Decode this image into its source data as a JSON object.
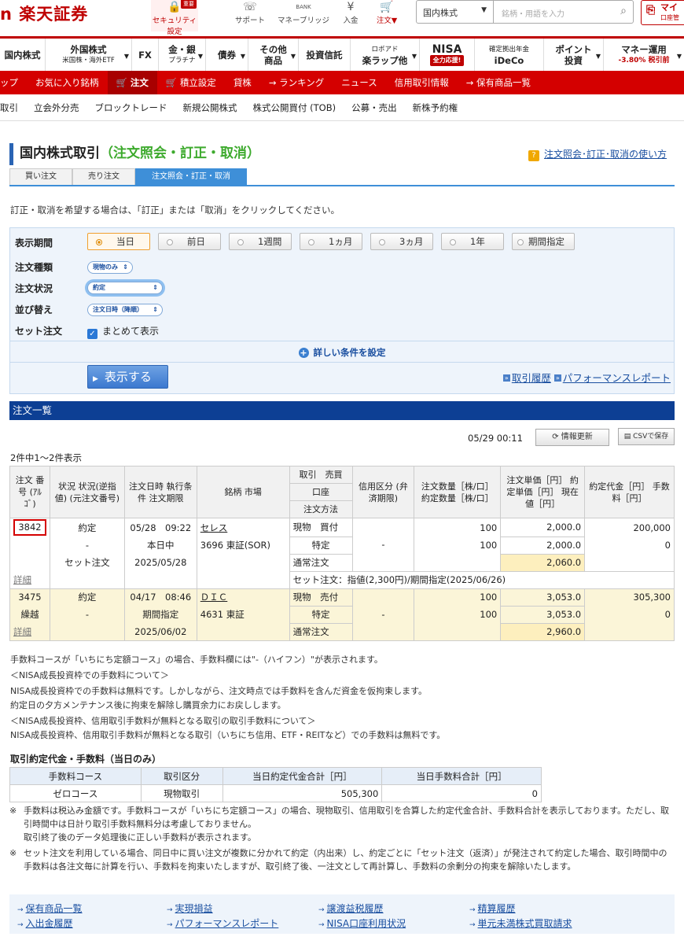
{
  "header": {
    "logo": "n 楽天証券",
    "icons": [
      {
        "label": "セキュリティ設定",
        "icon": "lock-icon",
        "badge": "重要"
      },
      {
        "label": "サポート",
        "icon": "support-icon"
      },
      {
        "label": "マネーブリッジ",
        "icon": "bank-icon",
        "small": "BANK"
      },
      {
        "label": "入金",
        "icon": "deposit-icon"
      },
      {
        "label": "注文▼",
        "icon": "cart-icon"
      }
    ],
    "market_select": "国内株式",
    "search_placeholder": "銘柄・用語を入力",
    "my": "マイ",
    "my_sub": "口座管"
  },
  "category_nav": [
    {
      "label": "国内株式"
    },
    {
      "label": "外国株式",
      "sub": "米国株・海外ETF",
      "dd": true
    },
    {
      "label": "FX"
    },
    {
      "label": "金・銀",
      "sub": "プラチナ",
      "dd": true
    },
    {
      "label": "債券",
      "dd": true
    },
    {
      "label": "その他",
      "sub": "商品",
      "dd": true
    },
    {
      "label": "投資信託"
    },
    {
      "label": "ロボアド",
      "sub": "楽ラップ他",
      "dd": true
    },
    {
      "label": "NISA",
      "sub": "全力応援!"
    },
    {
      "label": "確定拠出年金",
      "sub": "iDeCo"
    },
    {
      "label": "ポイント",
      "sub": "投資",
      "dd": true
    },
    {
      "label": "マネー運用",
      "sub": "-3.80% 税引前",
      "dd": true
    }
  ],
  "red_nav": [
    "ップ",
    "お気に入り銘柄",
    "注文",
    "積立設定",
    "貸株",
    "→ ランキング",
    "ニュース",
    "信用取引情報",
    "→ 保有商品一覧"
  ],
  "sub_nav": [
    "取引",
    "立会外分売",
    "ブロックトレード",
    "新規公開株式",
    "株式公開買付 (TOB)",
    "公募・売出",
    "新株予約権"
  ],
  "title": {
    "main": "国内株式取引",
    "sub": "（注文照会・訂正・取消）",
    "help": "注文照会･訂正･取消の使い方"
  },
  "tabs": [
    "買い注文",
    "売り注文",
    "注文照会・訂正・取消"
  ],
  "instruction": "訂正・取消を希望する場合は、「訂正」または「取消」をクリックしてください。",
  "filter": {
    "period_label": "表示期間",
    "periods": [
      "当日",
      "前日",
      "1週間",
      "1ヵ月",
      "3ヵ月",
      "1年",
      "期間指定"
    ],
    "type_label": "注文種類",
    "type_value": "現物のみ",
    "status_label": "注文状況",
    "status_value": "約定",
    "sort_label": "並び替え",
    "sort_value": "注文日時（降順）",
    "set_label": "セット注文",
    "set_check": "まとめて表示",
    "advanced": "詳しい条件を設定",
    "show_button": "表示する",
    "link_history": "取引履歴",
    "link_perf": "パフォーマンスレポート"
  },
  "list": {
    "heading": "注文一覧",
    "timestamp": "05/29 00:11",
    "refresh": "情報更新",
    "csv": "CSVで保存",
    "count": "2件中1〜2件表示",
    "headers": {
      "h1": "注文 番号 (ｱﾙｺﾞ)",
      "h2": "状況 状況(逆指値) (元注文番号)",
      "h3": "注文日時 執行条件 注文期限",
      "h4": "銘柄 市場",
      "h5a": "取引　売買",
      "h5b": "口座",
      "h5c": "注文方法",
      "h6": "信用区分 (弁済期限)",
      "h7": "注文数量［株/口］ 約定数量［株/口］",
      "h8": "注文単価［円］ 約定単価［円］ 現在値［円］",
      "h9": "約定代金［円］ 手数料［円］"
    },
    "rows": [
      {
        "id": "3842",
        "status": "約定",
        "status2": "-",
        "status3": "セット注文",
        "date": "05/28　09:22",
        "cond": "本日中",
        "limit": "2025/05/28",
        "name": "セレス",
        "code": "3696 東証(SOR)",
        "trade": "現物　買付",
        "account": "特定",
        "method": "通常注文",
        "credit": "-",
        "qty": "100",
        "exec_qty": "100",
        "price": "2,000.0",
        "exec_price": "2,000.0",
        "current": "2,060.0",
        "amount": "200,000",
        "fee": "0",
        "detail": "詳細",
        "set_note": "セット注文：指値(2,300円)/期間指定(2025/06/26)"
      },
      {
        "id": "3475",
        "sub": "繰越",
        "status": "約定",
        "status2": "-",
        "date": "04/17　08:46",
        "cond": "期間指定",
        "limit": "2025/06/02",
        "name": "ＤＩＣ",
        "code": "4631 東証",
        "trade": "現物　売付",
        "account": "特定",
        "method": "通常注文",
        "credit": "-",
        "qty": "100",
        "exec_qty": "100",
        "price": "3,053.0",
        "exec_price": "3,053.0",
        "current": "2,960.0",
        "amount": "305,300",
        "fee": "0",
        "detail": "詳細"
      }
    ]
  },
  "notes": [
    "手数料コースが「いちにち定額コース」の場合、手数料欄には\"-（ハイフン）\"が表示されます。",
    "＜NISA成長投資枠での手数料について＞",
    "NISA成長投資枠での手数料は無料です。しかしながら、注文時点では手数料を含んだ資金を仮拘束します。",
    "約定日の夕方メンテナンス後に拘束を解除し購買余力にお戻しします。",
    "＜NISA成長投資枠、信用取引手数料が無料となる取引の取引手数料について＞",
    "NISA成長投資枠、信用取引手数料が無料となる取引（いちにち信用、ETF・REITなど）での手数料は無料です。"
  ],
  "fee_summary": {
    "title": "取引約定代金・手数料（当日のみ）",
    "headers": [
      "手数料コース",
      "取引区分",
      "当日約定代金合計［円］",
      "当日手数料合計［円］"
    ],
    "row": [
      "ゼロコース",
      "現物取引",
      "505,300",
      "0"
    ]
  },
  "footnotes": [
    "手数料は税込み金額です。手数料コースが「いちにち定額コース」の場合、現物取引、信用取引を合算した約定代金合計、手数料合計を表示しております。ただし、取引時間中は日計り取引手数料無料分は考慮しておりません。",
    "取引終了後のデータ処理後に正しい手数料が表示されます。",
    "セット注文を利用している場合、同日中に買い注文が複数に分かれて約定（内出来）し、約定ごとに「セット注文（返済）」が発注されて約定した場合、取引時間中の手数料は各注文毎に計算を行い、手数料を拘束いたしますが、取引終了後、一注文として再計算し、手数料の余剰分の拘束を解除いたします。"
  ],
  "bottom_links": [
    "保有商品一覧",
    "実現損益",
    "譲渡益税履歴",
    "精算履歴",
    "入出金履歴",
    "パフォーマンスレポート",
    "NISA口座利用状況",
    "単元未満株式買取請求"
  ],
  "colors": {
    "brand_red": "#bf0000",
    "nav_blue": "#0d3f94",
    "tab_blue": "#3e8fd8",
    "highlight": "#fdefbe"
  }
}
